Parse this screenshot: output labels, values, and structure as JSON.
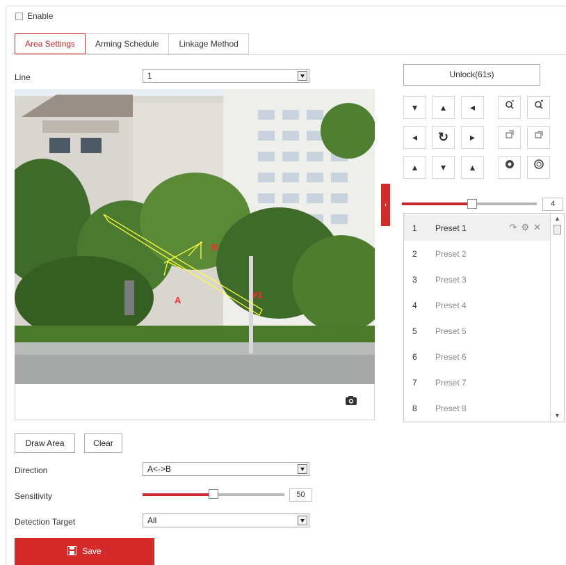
{
  "enable": {
    "label": "Enable",
    "checked": false
  },
  "tabs": [
    {
      "label": "Area Settings",
      "active": true
    },
    {
      "label": "Arming Schedule",
      "active": false
    },
    {
      "label": "Linkage Method",
      "active": false
    }
  ],
  "line": {
    "label": "Line",
    "value": "1"
  },
  "video": {
    "overlay_label_a": "A",
    "overlay_label_b": "B",
    "overlay_label_num": "#1",
    "snapshot_icon": "camera-icon"
  },
  "ptz": {
    "unlock_label": "Unlock(61s)",
    "speed_value": "4",
    "speed_level": 0.52,
    "buttons": [
      {
        "name": "ptz-up-left",
        "icon": "arrow-up-left-icon",
        "glyph": "▾"
      },
      {
        "name": "ptz-up",
        "icon": "arrow-up-icon",
        "glyph": "▴"
      },
      {
        "name": "ptz-up-right",
        "icon": "arrow-up-right-icon",
        "glyph": "◂"
      },
      {
        "name": "zoom-out",
        "icon": "zoom-out-icon",
        "glyph": "ɑ̄"
      },
      {
        "name": "zoom-in",
        "icon": "zoom-in-icon",
        "glyph": "ɑ⁺"
      },
      {
        "name": "ptz-left",
        "icon": "arrow-left-icon",
        "glyph": "◂"
      },
      {
        "name": "ptz-auto",
        "icon": "rotate-icon",
        "glyph": "↻"
      },
      {
        "name": "ptz-right",
        "icon": "arrow-right-icon",
        "glyph": "▸"
      },
      {
        "name": "focus-near",
        "icon": "focus-near-icon",
        "glyph": "⌐"
      },
      {
        "name": "focus-far",
        "icon": "focus-far-icon",
        "glyph": "⌐"
      },
      {
        "name": "ptz-down-left",
        "icon": "arrow-down-left-icon",
        "glyph": "▴"
      },
      {
        "name": "ptz-down",
        "icon": "arrow-down-icon",
        "glyph": "▾"
      },
      {
        "name": "ptz-down-right",
        "icon": "arrow-down-right-icon",
        "glyph": "▴"
      },
      {
        "name": "iris-close",
        "icon": "iris-close-icon",
        "glyph": "◉"
      },
      {
        "name": "iris-open",
        "icon": "iris-open-icon",
        "glyph": "○"
      }
    ]
  },
  "presets": [
    {
      "no": "1",
      "name": "Preset 1"
    },
    {
      "no": "2",
      "name": "Preset 2"
    },
    {
      "no": "3",
      "name": "Preset 3"
    },
    {
      "no": "4",
      "name": "Preset 4"
    },
    {
      "no": "5",
      "name": "Preset 5"
    },
    {
      "no": "6",
      "name": "Preset 6"
    },
    {
      "no": "7",
      "name": "Preset 7"
    },
    {
      "no": "8",
      "name": "Preset 8"
    }
  ],
  "draw_area_label": "Draw Area",
  "clear_label": "Clear",
  "direction": {
    "label": "Direction",
    "value": "A<->B"
  },
  "sensitivity": {
    "label": "Sensitivity",
    "value": "50",
    "level": 0.5
  },
  "detection_target": {
    "label": "Detection Target",
    "value": "All"
  },
  "save_label": "Save",
  "colors": {
    "accent": "#c8282e",
    "save_bg": "#d42a2a",
    "overlay_line": "#ffff3a",
    "overlay_text": "#ff2a2a"
  }
}
